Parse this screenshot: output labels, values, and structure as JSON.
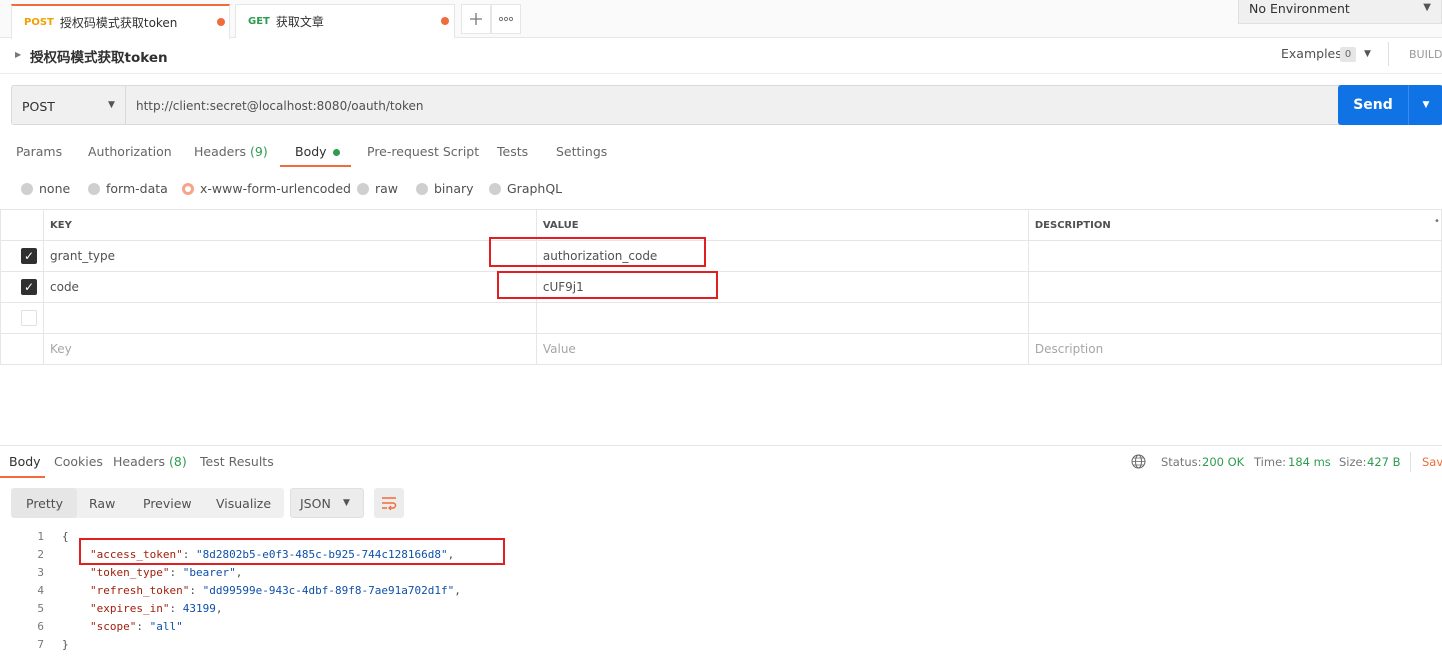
{
  "tabs": [
    {
      "method": "POST",
      "title": "授权码模式获取token",
      "method_color": "#f0a000"
    },
    {
      "method": "GET",
      "title": "获取文章",
      "method_color": "#2e9c4f"
    }
  ],
  "environment": "No Environment",
  "request_name": "授权码模式获取token",
  "examples_label": "Examples",
  "examples_count": "0",
  "build_label": "BUILD",
  "method": "POST",
  "url": "http://client:secret@localhost:8080/oauth/token",
  "send_label": "Send",
  "request_tabs": {
    "params": "Params",
    "authorization": "Authorization",
    "headers": "Headers",
    "headers_count": "(9)",
    "body": "Body",
    "prerequest": "Pre-request Script",
    "tests": "Tests",
    "settings": "Settings"
  },
  "body_types": [
    "none",
    "form-data",
    "x-www-form-urlencoded",
    "raw",
    "binary",
    "GraphQL"
  ],
  "table_headers": {
    "key": "KEY",
    "value": "VALUE",
    "description": "DESCRIPTION"
  },
  "rows": [
    {
      "key": "grant_type",
      "value": "authorization_code"
    },
    {
      "key": "code",
      "value": "cUF9j1"
    }
  ],
  "placeholders": {
    "key": "Key",
    "value": "Value",
    "description": "Description"
  },
  "response_tabs": {
    "body": "Body",
    "cookies": "Cookies",
    "headers": "Headers",
    "headers_count": "(8)",
    "tests": "Test Results"
  },
  "status": {
    "status_label": "Status:",
    "status_value": "200 OK",
    "time_label": "Time:",
    "time_value": "184 ms",
    "size_label": "Size:",
    "size_value": "427 B",
    "save": "Sav"
  },
  "view_modes": [
    "Pretty",
    "Raw",
    "Preview",
    "Visualize"
  ],
  "format": "JSON",
  "json_lines": [
    "1",
    "2",
    "3",
    "4",
    "5",
    "6",
    "7"
  ],
  "json": {
    "open": "{",
    "close": "}",
    "l2k": "\"access_token\"",
    "l2v": "\"8d2802b5-e0f3-485c-b925-744c128166d8\"",
    "l3k": "\"token_type\"",
    "l3v": "\"bearer\"",
    "l4k": "\"refresh_token\"",
    "l4v": "\"dd99599e-943c-4dbf-89f8-7ae91a702d1f\"",
    "l5k": "\"expires_in\"",
    "l5v": "43199",
    "l6k": "\"scope\"",
    "l6v": "\"all\""
  }
}
